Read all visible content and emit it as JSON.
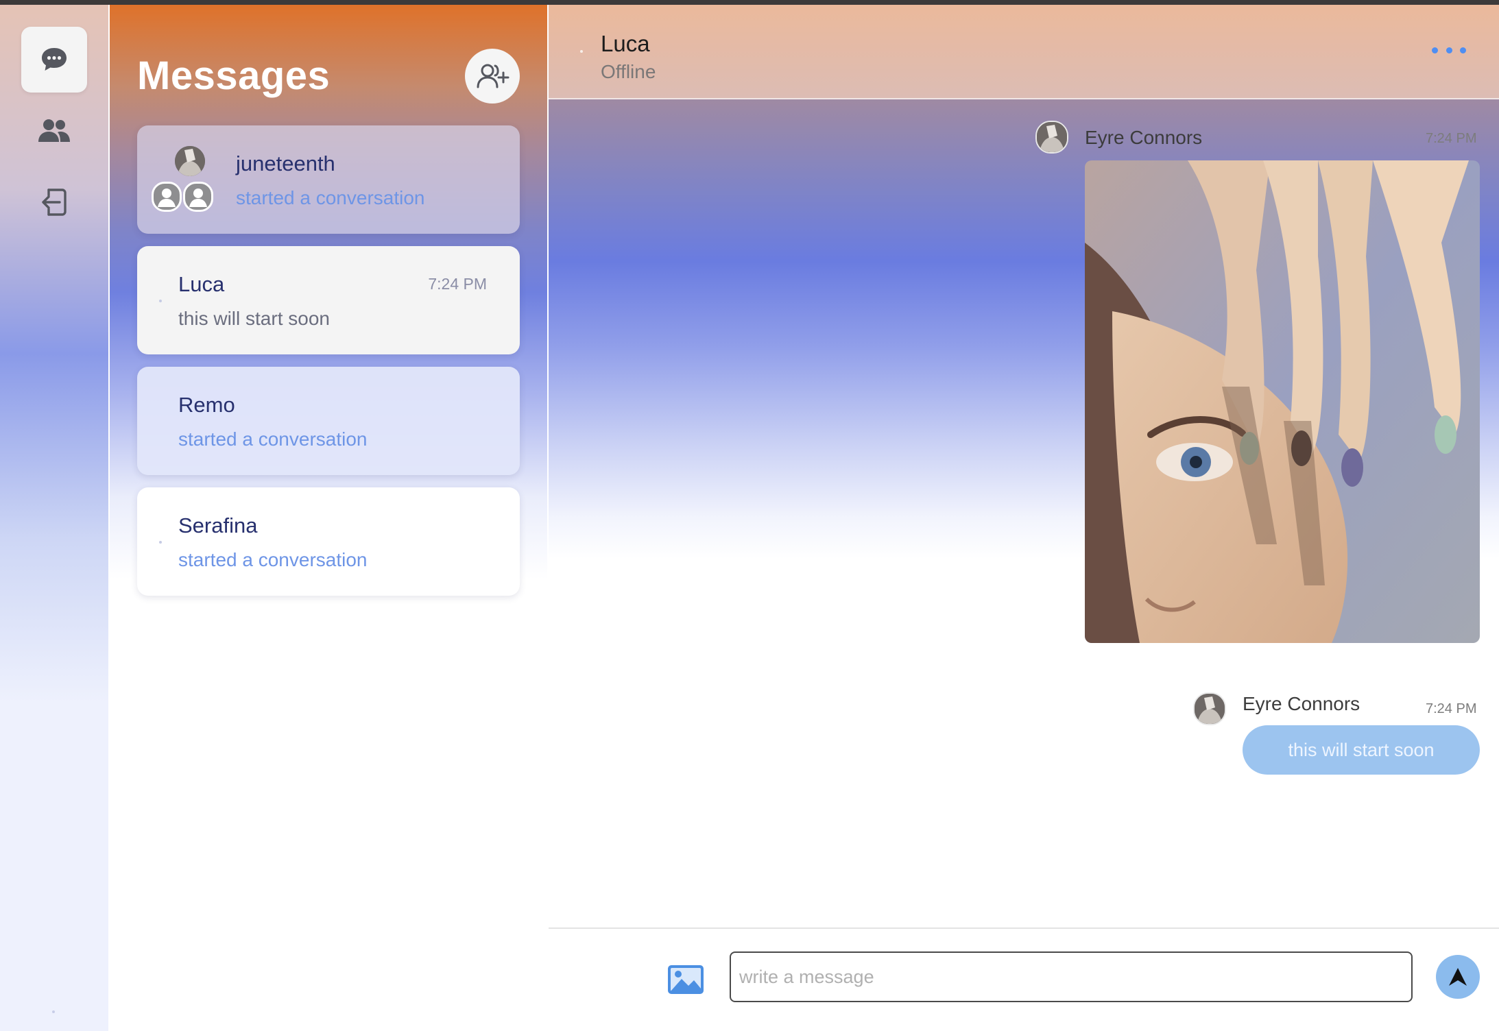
{
  "sidebar": {
    "icons": [
      "chat-bubble-icon",
      "users-icon",
      "logout-icon"
    ]
  },
  "conversations_panel": {
    "title": "Messages",
    "add_icon": "add-user-icon",
    "items": [
      {
        "name": "juneteenth",
        "preview": "started a conversation",
        "time": "",
        "type": "group"
      },
      {
        "name": "Luca",
        "preview": "this will start soon",
        "time": "7:24 PM",
        "type": "direct"
      },
      {
        "name": "Remo",
        "preview": "started a conversation",
        "time": "",
        "type": "direct"
      },
      {
        "name": "Serafina",
        "preview": "started a conversation",
        "time": "",
        "type": "direct"
      }
    ]
  },
  "chat": {
    "header": {
      "name": "Luca",
      "status": "Offline",
      "menu_icon": "more-horizontal-icon"
    },
    "messages": [
      {
        "sender": "Eyre Connors",
        "time": "7:24 PM",
        "kind": "image"
      },
      {
        "sender": "Eyre Connors",
        "time": "7:24 PM",
        "kind": "text",
        "text": "this will start soon"
      }
    ],
    "composer": {
      "placeholder": "write a message",
      "value": "",
      "image_icon": "image-icon",
      "send_icon": "send-arrow-icon"
    }
  },
  "colors": {
    "accent_blue": "#4f8ef2",
    "name_text": "#27306e",
    "preview_text": "#6e95e6",
    "bubble": "#9cc4ef",
    "send_button": "#8bbbed",
    "panel_top": "#df722a"
  }
}
